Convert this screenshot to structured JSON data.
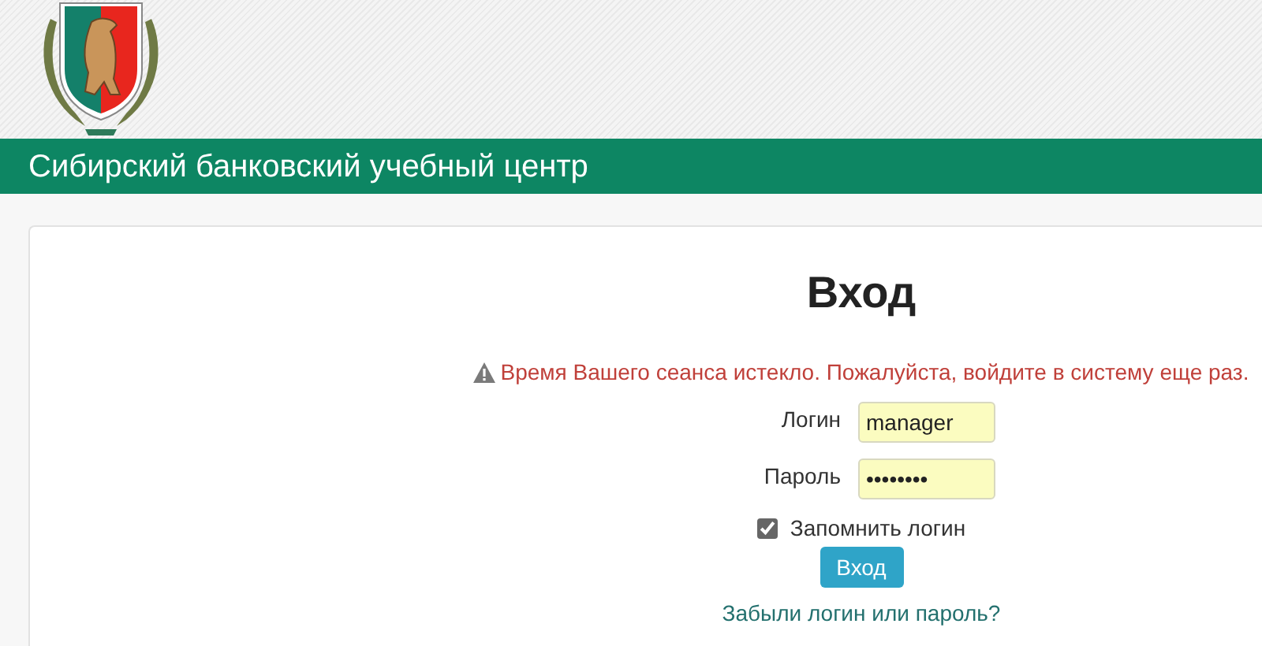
{
  "header": {
    "title": "Сибирский банковский учебный центр"
  },
  "login_form": {
    "heading": "Вход",
    "alert": "Время Вашего сеанса истекло. Пожалуйста, войдите в систему еще раз.",
    "fields": [
      {
        "label": "Логин",
        "value": "manager"
      },
      {
        "label": "Пароль",
        "value": "••••••••"
      }
    ],
    "remember": {
      "label": "Запомнить логин",
      "checked": true
    },
    "submit": "Вход",
    "forgot_link": "Забыли логин или пароль?"
  }
}
